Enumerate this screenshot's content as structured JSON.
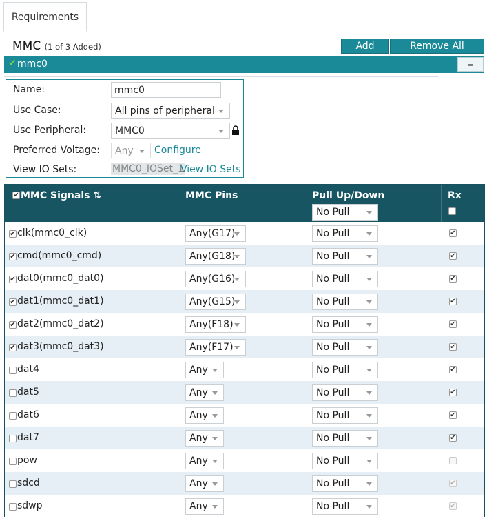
{
  "tabs": [
    {
      "label": "Requirements"
    }
  ],
  "peripheral": {
    "name": "MMC",
    "count_text": "(1 of 3 Added)",
    "add_label": "Add",
    "remove_all_label": "Remove All",
    "instance_label": "mmc0",
    "collapse_symbol": "–"
  },
  "config": {
    "name_label": "Name:",
    "name_value": "mmc0",
    "use_case_label": "Use Case:",
    "use_case_value": "All pins of peripheral",
    "use_peripheral_label": "Use Peripheral:",
    "use_peripheral_value": "MMC0",
    "voltage_label": "Preferred Voltage:",
    "voltage_value": "Any",
    "configure_link": "Configure",
    "io_sets_label": "View IO Sets:",
    "io_set_value": "MMC0_IOSet_1",
    "view_io_sets_link": "View IO Sets"
  },
  "table": {
    "headers": {
      "signals": "MMC Signals",
      "sort_glyph": "⇅",
      "pins": "MMC Pins",
      "pull": "Pull Up/Down",
      "rx": "Rx"
    },
    "header_pull_value": "No Pull",
    "rows": [
      {
        "signal": "clk(mmc0_clk)",
        "pin": "Any(G17)",
        "pull": "No Pull",
        "checked": true,
        "rx": true,
        "rx_disabled": false
      },
      {
        "signal": "cmd(mmc0_cmd)",
        "pin": "Any(G18)",
        "pull": "No Pull",
        "checked": true,
        "rx": true,
        "rx_disabled": false
      },
      {
        "signal": "dat0(mmc0_dat0)",
        "pin": "Any(G16)",
        "pull": "No Pull",
        "checked": true,
        "rx": true,
        "rx_disabled": false
      },
      {
        "signal": "dat1(mmc0_dat1)",
        "pin": "Any(G15)",
        "pull": "No Pull",
        "checked": true,
        "rx": true,
        "rx_disabled": false
      },
      {
        "signal": "dat2(mmc0_dat2)",
        "pin": "Any(F18)",
        "pull": "No Pull",
        "checked": true,
        "rx": true,
        "rx_disabled": false
      },
      {
        "signal": "dat3(mmc0_dat3)",
        "pin": "Any(F17)",
        "pull": "No Pull",
        "checked": true,
        "rx": true,
        "rx_disabled": false
      },
      {
        "signal": "dat4",
        "pin": "Any",
        "pull": "No Pull",
        "checked": false,
        "rx": true,
        "rx_disabled": false
      },
      {
        "signal": "dat5",
        "pin": "Any",
        "pull": "No Pull",
        "checked": false,
        "rx": true,
        "rx_disabled": false
      },
      {
        "signal": "dat6",
        "pin": "Any",
        "pull": "No Pull",
        "checked": false,
        "rx": true,
        "rx_disabled": false
      },
      {
        "signal": "dat7",
        "pin": "Any",
        "pull": "No Pull",
        "checked": false,
        "rx": true,
        "rx_disabled": false
      },
      {
        "signal": "pow",
        "pin": "Any",
        "pull": "No Pull",
        "checked": false,
        "rx": false,
        "rx_disabled": true
      },
      {
        "signal": "sdcd",
        "pin": "Any",
        "pull": "No Pull",
        "checked": false,
        "rx": true,
        "rx_disabled": true
      },
      {
        "signal": "sdwp",
        "pin": "Any",
        "pull": "No Pull",
        "checked": false,
        "rx": true,
        "rx_disabled": true
      }
    ]
  },
  "icons": {
    "check": "check-icon",
    "lock": "lock-icon",
    "caret": "caret-down-icon",
    "sort": "sort-icon"
  },
  "colors": {
    "accent": "#1b8a98",
    "header": "#175563",
    "row_alt": "#e5eff5",
    "success": "#7ed04b"
  }
}
